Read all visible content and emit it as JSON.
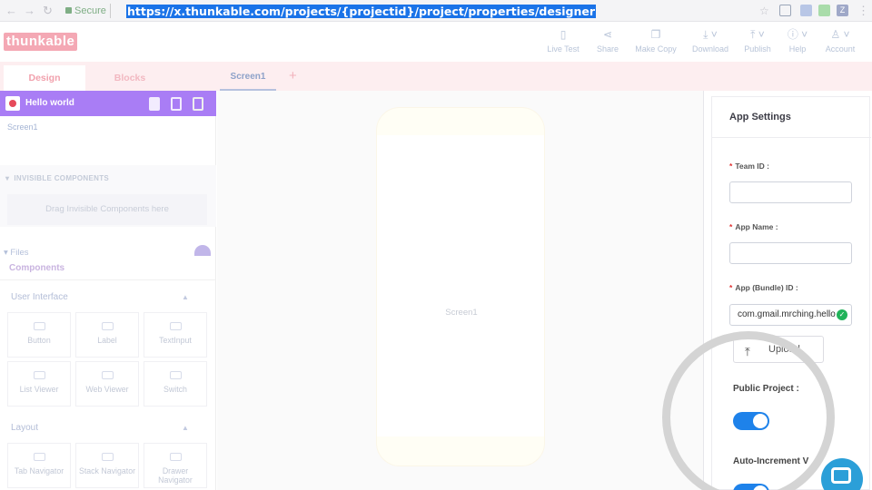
{
  "browser": {
    "secure_label": "Secure",
    "url": "https://x.thunkable.com/projects/{projectid}/project/properties/designer"
  },
  "header": {
    "logo": "thunkable",
    "tools": [
      "Live Test",
      "Share",
      "Make Copy",
      "Download",
      "Publish",
      "Help",
      "Account"
    ]
  },
  "tabs": {
    "design": "Design",
    "blocks": "Blocks",
    "screen": "Screen1",
    "add": "+"
  },
  "left_panel": {
    "project_name": "Hello world",
    "screen_item": "Screen1",
    "invisible_title": "INVISIBLE COMPONENTS",
    "drag_hint": "Drag Invisible Components here",
    "files": "Files",
    "components_title": "Components",
    "groups": [
      {
        "title": "User Interface",
        "items": [
          "Button",
          "Label",
          "TextInput",
          "List Viewer",
          "Web Viewer",
          "Switch"
        ]
      },
      {
        "title": "Layout",
        "items": [
          "Tab Navigator",
          "Stack Navigator",
          "Drawer Navigator"
        ]
      }
    ]
  },
  "canvas": {
    "screen_label": "Screen1"
  },
  "settings": {
    "title": "App Settings",
    "team_id_label": "Team ID :",
    "team_id_value": "",
    "app_name_label": "App Name :",
    "app_name_value": "",
    "bundle_label": "App (Bundle) ID :",
    "bundle_value": "com.gmail.mrching.hello",
    "upload_label": "Upload",
    "public_label": "Public Project :",
    "public_on": true,
    "auto_label": "Auto-Increment V",
    "toggle_color": "#1e82ea"
  }
}
